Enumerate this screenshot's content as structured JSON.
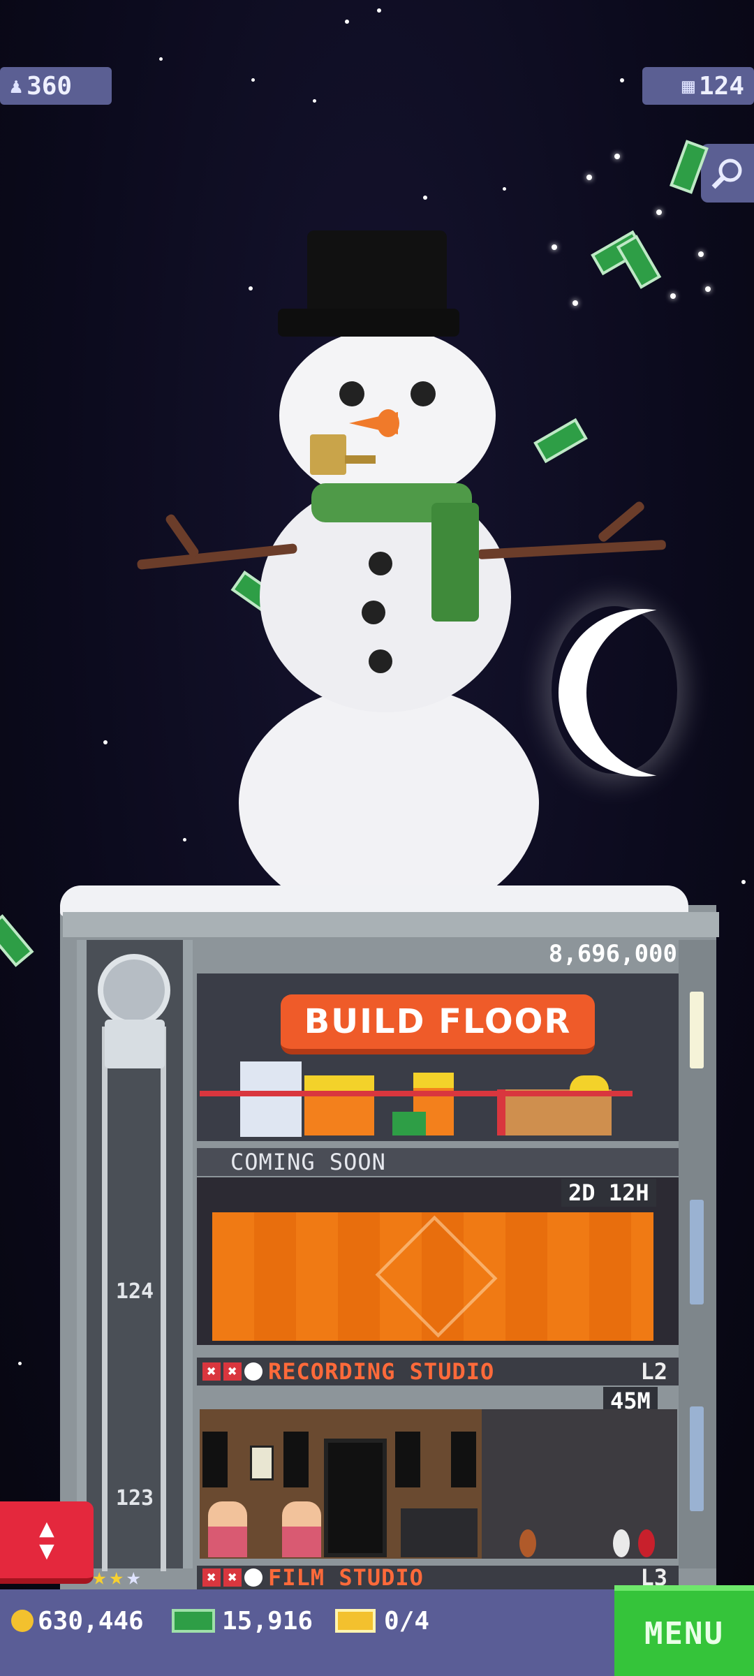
{
  "hud": {
    "population": "360",
    "population_icon": "person-icon",
    "floors": "124",
    "floors_icon": "building-icon"
  },
  "zoom_button_icon": "magnifier-icon",
  "tower": {
    "build_floor_price": "8,696,000",
    "build_floor_label": "BUILD FLOOR",
    "coming_soon_label": "COMING SOON",
    "construction_timer": "2D 12H",
    "floor_124": {
      "number": "124",
      "name": "RECORDING STUDIO",
      "level": "L2"
    },
    "floor_123": {
      "number": "123",
      "timer": "45M",
      "name": "FILM STUDIO",
      "level": "L3"
    }
  },
  "bottom_bar": {
    "coins": "630,446",
    "bux": "15,916",
    "tickets": "0/4",
    "menu_label": "MENU"
  },
  "colors": {
    "hud_bg": "#5b5f93",
    "build_button": "#ef5b29",
    "menu_button": "#35c43a",
    "elevator_button": "#e4283d",
    "floor_title": "#ff6a3a"
  }
}
